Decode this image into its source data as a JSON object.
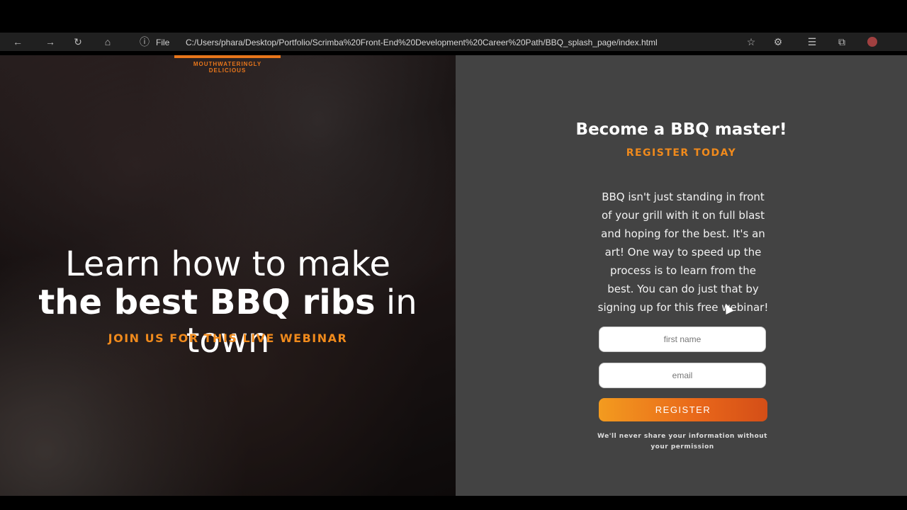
{
  "browser": {
    "page_label": "File",
    "url": "C:/Users/phara/Desktop/Portfolio/Scrimba%20Front-End%20Development%20Career%20Path/BBQ_splash_page/index.html",
    "icons": [
      "back-icon",
      "forward-icon",
      "refresh-icon",
      "home-icon",
      "info-icon",
      "favorite-icon",
      "extensions-icon",
      "collections-icon",
      "tabs-icon",
      "profile-avatar"
    ]
  },
  "hero": {
    "tagline": "MOUTHWATERINGLY DELICIOUS",
    "title_part1": "Learn how to make ",
    "title_bold1": "the best BBQ ribs",
    "title_part2": " in town",
    "subtitle": "JOIN US FOR THIS LIVE WEBINAR"
  },
  "signup": {
    "heading": "Become a BBQ master!",
    "subheading": "REGISTER TODAY",
    "body": "BBQ isn't just standing in front of your grill with it on full blast and hoping for the best. It's an art! One way to speed up the process is to learn from the best. You can do just that by signing up for this free webinar!",
    "first_name_placeholder": "first name",
    "email_placeholder": "email",
    "register_label": "REGISTER",
    "disclaimer": "We'll never share your information without your permission"
  },
  "colors": {
    "accent": "#f08a1c",
    "panel_bg": "#434343",
    "button_gradient_start": "#f39b1f",
    "button_gradient_end": "#d44e17"
  }
}
